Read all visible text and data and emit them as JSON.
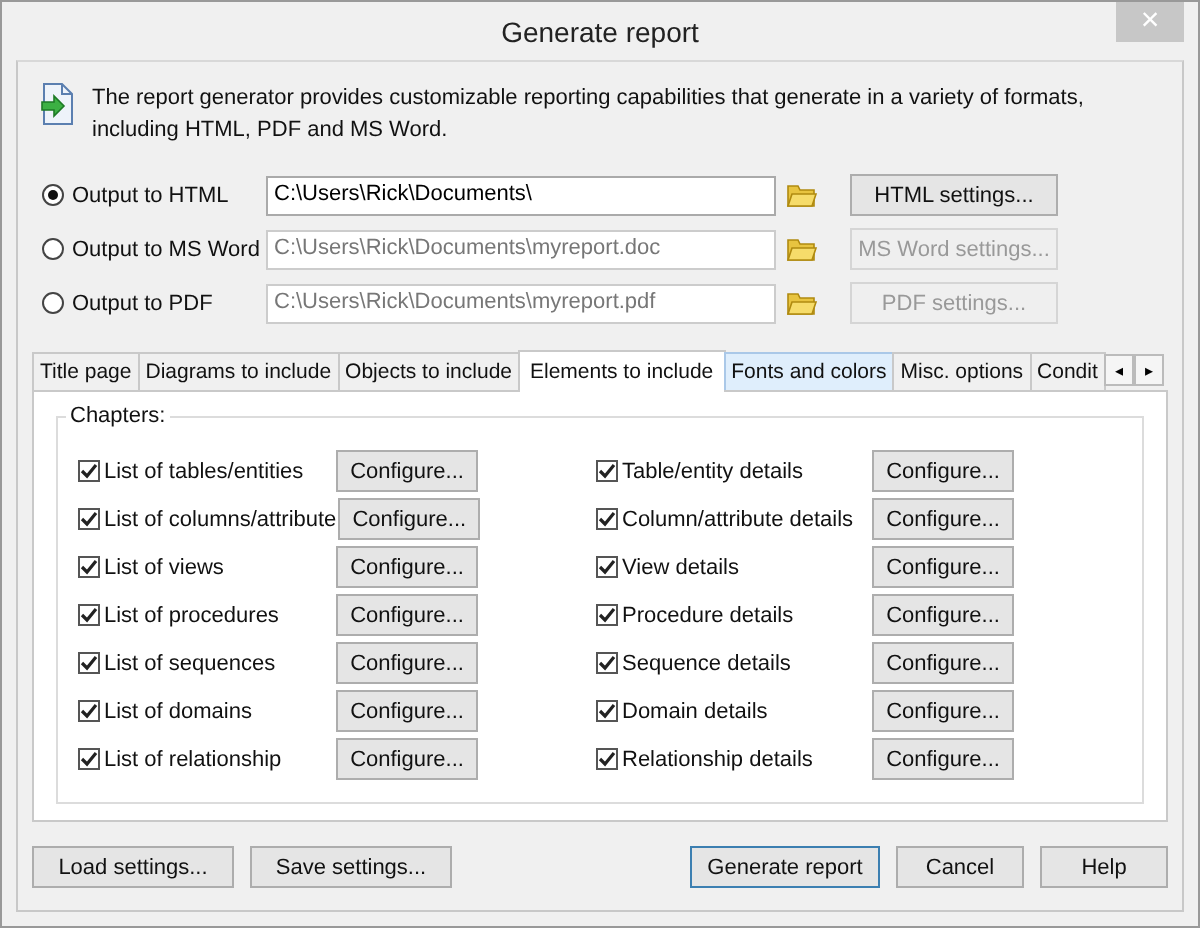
{
  "window": {
    "title": "Generate report",
    "close": "×"
  },
  "description": "The report generator provides customizable reporting capabilities that generate in a variety of formats, including HTML, PDF and MS Word.",
  "outputs": [
    {
      "label": "Output to HTML",
      "selected": true,
      "path": "C:\\Users\\Rick\\Documents\\",
      "disabled": false,
      "button": "HTML settings..."
    },
    {
      "label": "Output to MS Word",
      "selected": false,
      "path": "C:\\Users\\Rick\\Documents\\myreport.doc",
      "disabled": true,
      "button": "MS Word settings..."
    },
    {
      "label": "Output to PDF",
      "selected": false,
      "path": "C:\\Users\\Rick\\Documents\\myreport.pdf",
      "disabled": true,
      "button": "PDF settings..."
    }
  ],
  "tabs": [
    {
      "label": "Title page",
      "selected": false,
      "hovered": false
    },
    {
      "label": "Diagrams to include",
      "selected": false,
      "hovered": false
    },
    {
      "label": "Objects to include",
      "selected": false,
      "hovered": false
    },
    {
      "label": "Elements to include",
      "selected": true,
      "hovered": false
    },
    {
      "label": "Fonts and colors",
      "selected": false,
      "hovered": true
    },
    {
      "label": "Misc. options",
      "selected": false,
      "hovered": false
    },
    {
      "label": "Condit",
      "selected": false,
      "hovered": false
    }
  ],
  "tab_scroll": [
    "◂",
    "▸"
  ],
  "chapters": {
    "title": "Chapters:",
    "items": [
      {
        "label": "List of tables/entities",
        "checked": true,
        "button": "Configure..."
      },
      {
        "label": "Table/entity details",
        "checked": true,
        "button": "Configure..."
      },
      {
        "label": "List of columns/attribute",
        "checked": true,
        "button": "Configure..."
      },
      {
        "label": "Column/attribute details",
        "checked": true,
        "button": "Configure..."
      },
      {
        "label": "List of views",
        "checked": true,
        "button": "Configure..."
      },
      {
        "label": "View details",
        "checked": true,
        "button": "Configure..."
      },
      {
        "label": "List of procedures",
        "checked": true,
        "button": "Configure..."
      },
      {
        "label": "Procedure details",
        "checked": true,
        "button": "Configure..."
      },
      {
        "label": "List of sequences",
        "checked": true,
        "button": "Configure..."
      },
      {
        "label": "Sequence details",
        "checked": true,
        "button": "Configure..."
      },
      {
        "label": "List of domains",
        "checked": true,
        "button": "Configure..."
      },
      {
        "label": "Domain details",
        "checked": true,
        "button": "Configure..."
      },
      {
        "label": "List of relationship",
        "checked": true,
        "button": "Configure..."
      },
      {
        "label": "Relationship details",
        "checked": true,
        "button": "Configure..."
      }
    ]
  },
  "buttons_left": [
    "Load settings...",
    "Save settings..."
  ],
  "buttons_right": [
    {
      "label": "Generate report",
      "kind": "default"
    },
    {
      "label": "Cancel",
      "kind": "normal"
    },
    {
      "label": "Help",
      "kind": "normal"
    }
  ]
}
